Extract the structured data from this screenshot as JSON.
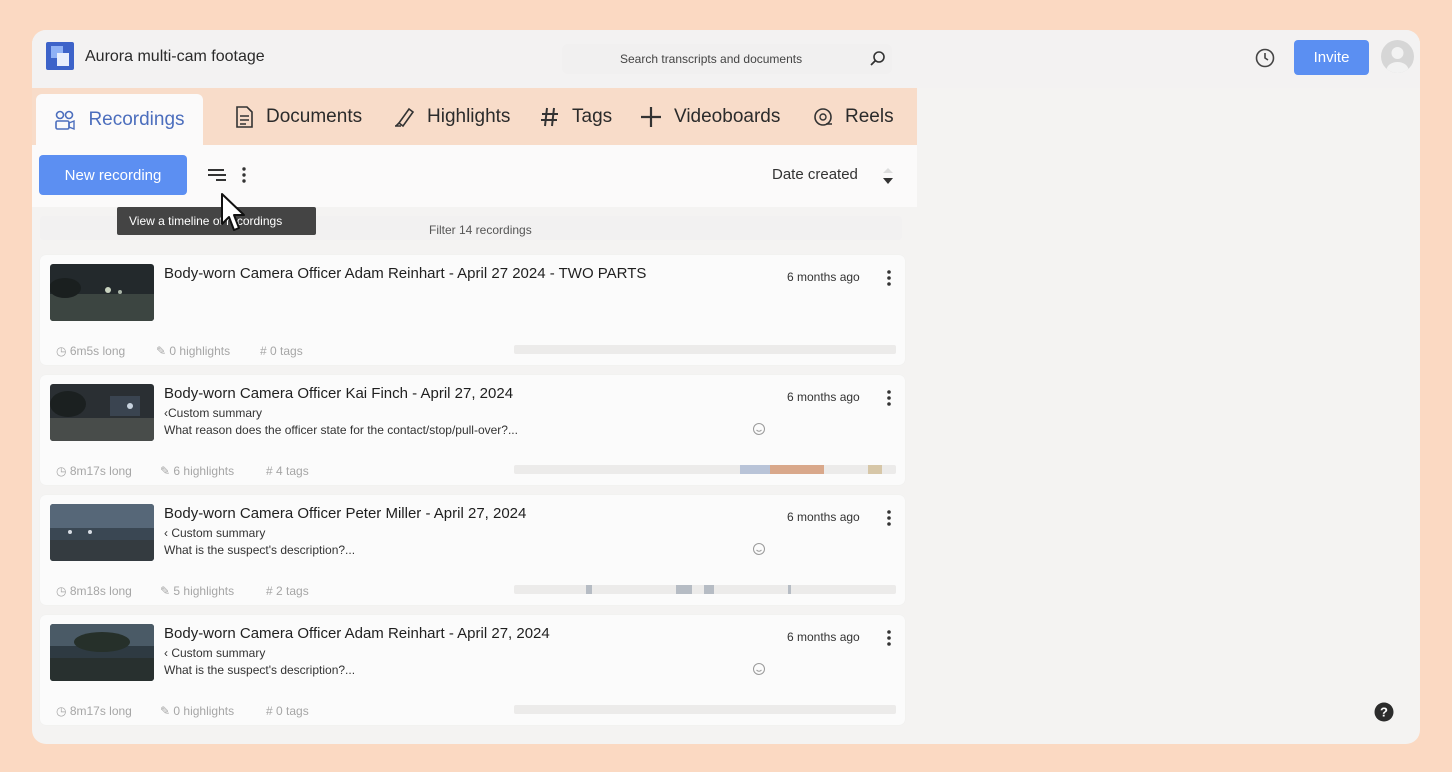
{
  "app": {
    "title": "Aurora multi-cam footage",
    "search_placeholder": "Search transcripts and documents",
    "invite_label": "Invite"
  },
  "tabs": [
    {
      "label": "Recordings",
      "icon": "recordings-icon",
      "active": true
    },
    {
      "label": "Documents",
      "icon": "document-icon"
    },
    {
      "label": "Highlights",
      "icon": "highlighter-icon"
    },
    {
      "label": "Tags",
      "icon": "hash-icon"
    },
    {
      "label": "Videoboards",
      "icon": "plus-icon"
    },
    {
      "label": "Reels",
      "icon": "reel-icon"
    }
  ],
  "toolbar": {
    "new_recording_label": "New recording",
    "sort_label": "Date created",
    "tooltip": "View a timeline of recordings"
  },
  "filter": {
    "placeholder": "Filter 14 recordings"
  },
  "recordings": [
    {
      "title": "Body-worn Camera Officer Adam Reinhart - April 27 2024 - TWO PARTS",
      "summary_label": "",
      "question": "",
      "time_ago": "6 months ago",
      "duration": "6m5s long",
      "highlights": "0 highlights",
      "tags": "# 0 tags"
    },
    {
      "title": "Body-worn Camera Officer Kai Finch - April 27, 2024",
      "summary_label": "‹Custom summary",
      "question": "What reason does the officer state for the contact/stop/pull-over?...",
      "time_ago": "6 months ago",
      "duration": "8m17s long",
      "highlights": "6 highlights",
      "tags": "# 4 tags"
    },
    {
      "title": "Body-worn Camera Officer Peter Miller - April 27, 2024",
      "summary_label": "‹ Custom summary",
      "question": "What is the suspect's description?...",
      "time_ago": "6 months ago",
      "duration": "8m18s long",
      "highlights": "5 highlights",
      "tags": "# 2 tags"
    },
    {
      "title": "Body-worn Camera Officer Adam Reinhart - April 27, 2024",
      "summary_label": "‹ Custom summary",
      "question": "What is the suspect's description?...",
      "time_ago": "6 months ago",
      "duration": "8m17s long",
      "highlights": "0 highlights",
      "tags": "# 0 tags"
    }
  ],
  "colors": {
    "accent": "#5b8ff2",
    "active_tab_text": "#4c6ebd",
    "tab_bar": "#f8dcc9",
    "frame": "#fbd9c2"
  }
}
